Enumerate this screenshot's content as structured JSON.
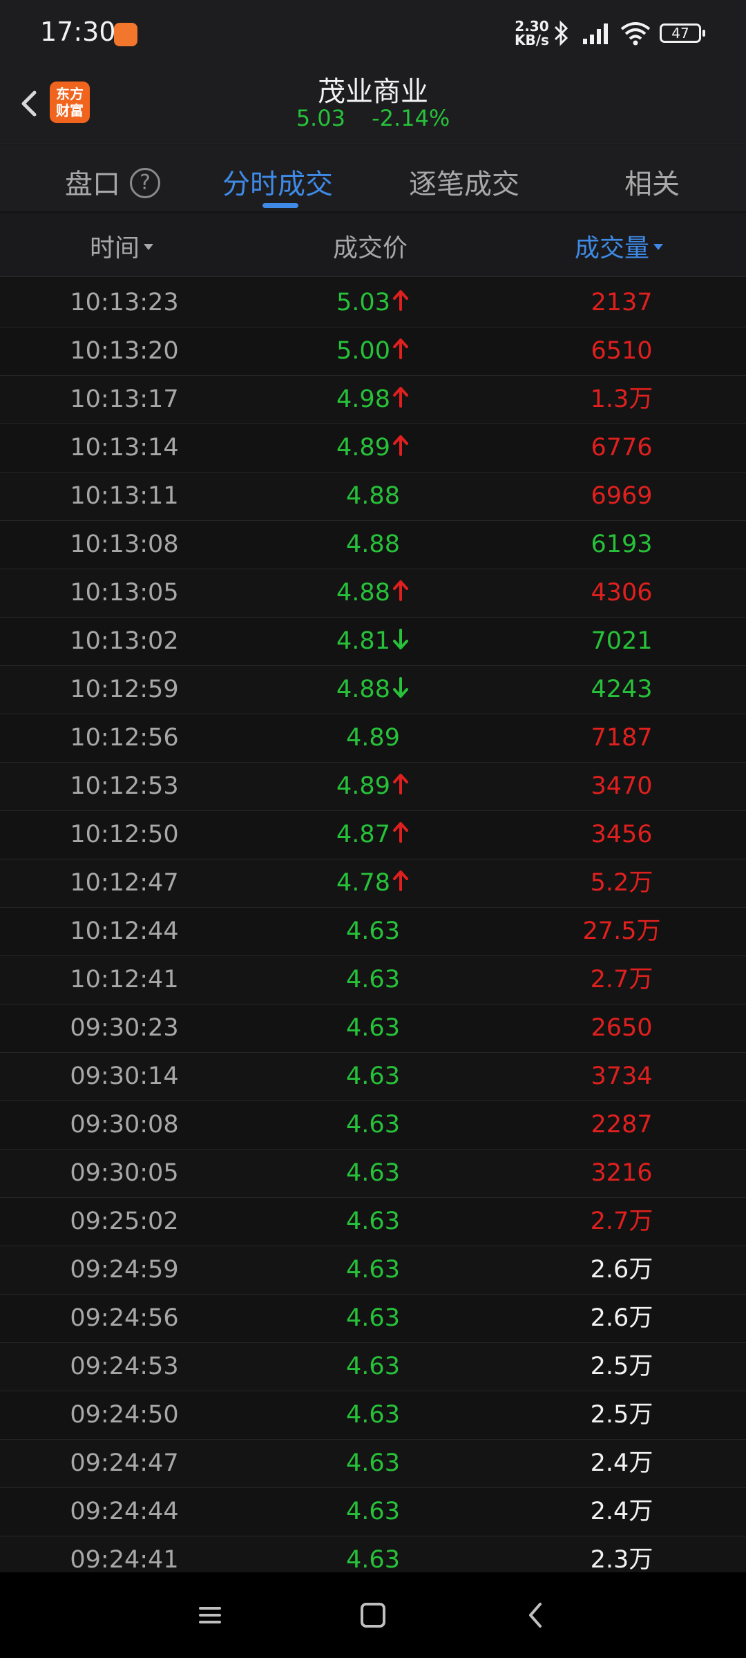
{
  "status_bar": {
    "time": "17:30",
    "net_speed_value": "2.30",
    "net_speed_unit": "KB/s",
    "battery": "47"
  },
  "header": {
    "logo_text_line1": "东方",
    "logo_text_line2": "财富",
    "stock_name": "茂业商业",
    "price": "5.03",
    "change_pct": "-2.14%"
  },
  "tabs": [
    {
      "label": "盘口"
    },
    {
      "label": "分时成交"
    },
    {
      "label": "逐笔成交"
    },
    {
      "label": "相关"
    }
  ],
  "active_tab": "分时成交",
  "columns": {
    "time": "时间",
    "price": "成交价",
    "volume": "成交量"
  },
  "colors": {
    "up": "#e0201e",
    "down": "#27c13a",
    "accent": "#3f8ae6",
    "neutral": "#f2f2f2"
  },
  "trades": [
    {
      "time": "10:13:23",
      "price": "5.03",
      "dir": "up",
      "volume": "2137",
      "vol_color": "red"
    },
    {
      "time": "10:13:20",
      "price": "5.00",
      "dir": "up",
      "volume": "6510",
      "vol_color": "red"
    },
    {
      "time": "10:13:17",
      "price": "4.98",
      "dir": "up",
      "volume": "1.3万",
      "vol_color": "red"
    },
    {
      "time": "10:13:14",
      "price": "4.89",
      "dir": "up",
      "volume": "6776",
      "vol_color": "red"
    },
    {
      "time": "10:13:11",
      "price": "4.88",
      "dir": "",
      "volume": "6969",
      "vol_color": "red"
    },
    {
      "time": "10:13:08",
      "price": "4.88",
      "dir": "",
      "volume": "6193",
      "vol_color": "green"
    },
    {
      "time": "10:13:05",
      "price": "4.88",
      "dir": "up",
      "volume": "4306",
      "vol_color": "red"
    },
    {
      "time": "10:13:02",
      "price": "4.81",
      "dir": "down",
      "volume": "7021",
      "vol_color": "green"
    },
    {
      "time": "10:12:59",
      "price": "4.88",
      "dir": "down",
      "volume": "4243",
      "vol_color": "green"
    },
    {
      "time": "10:12:56",
      "price": "4.89",
      "dir": "",
      "volume": "7187",
      "vol_color": "red"
    },
    {
      "time": "10:12:53",
      "price": "4.89",
      "dir": "up",
      "volume": "3470",
      "vol_color": "red"
    },
    {
      "time": "10:12:50",
      "price": "4.87",
      "dir": "up",
      "volume": "3456",
      "vol_color": "red"
    },
    {
      "time": "10:12:47",
      "price": "4.78",
      "dir": "up",
      "volume": "5.2万",
      "vol_color": "red"
    },
    {
      "time": "10:12:44",
      "price": "4.63",
      "dir": "",
      "volume": "27.5万",
      "vol_color": "red"
    },
    {
      "time": "10:12:41",
      "price": "4.63",
      "dir": "",
      "volume": "2.7万",
      "vol_color": "red"
    },
    {
      "time": "09:30:23",
      "price": "4.63",
      "dir": "",
      "volume": "2650",
      "vol_color": "red"
    },
    {
      "time": "09:30:14",
      "price": "4.63",
      "dir": "",
      "volume": "3734",
      "vol_color": "red"
    },
    {
      "time": "09:30:08",
      "price": "4.63",
      "dir": "",
      "volume": "2287",
      "vol_color": "red"
    },
    {
      "time": "09:30:05",
      "price": "4.63",
      "dir": "",
      "volume": "3216",
      "vol_color": "red"
    },
    {
      "time": "09:25:02",
      "price": "4.63",
      "dir": "",
      "volume": "2.7万",
      "vol_color": "red"
    },
    {
      "time": "09:24:59",
      "price": "4.63",
      "dir": "",
      "volume": "2.6万",
      "vol_color": "white"
    },
    {
      "time": "09:24:56",
      "price": "4.63",
      "dir": "",
      "volume": "2.6万",
      "vol_color": "white"
    },
    {
      "time": "09:24:53",
      "price": "4.63",
      "dir": "",
      "volume": "2.5万",
      "vol_color": "white"
    },
    {
      "time": "09:24:50",
      "price": "4.63",
      "dir": "",
      "volume": "2.5万",
      "vol_color": "white"
    },
    {
      "time": "09:24:47",
      "price": "4.63",
      "dir": "",
      "volume": "2.4万",
      "vol_color": "white"
    },
    {
      "time": "09:24:44",
      "price": "4.63",
      "dir": "",
      "volume": "2.4万",
      "vol_color": "white"
    },
    {
      "time": "09:24:41",
      "price": "4.63",
      "dir": "",
      "volume": "2.3万",
      "vol_color": "white"
    }
  ]
}
